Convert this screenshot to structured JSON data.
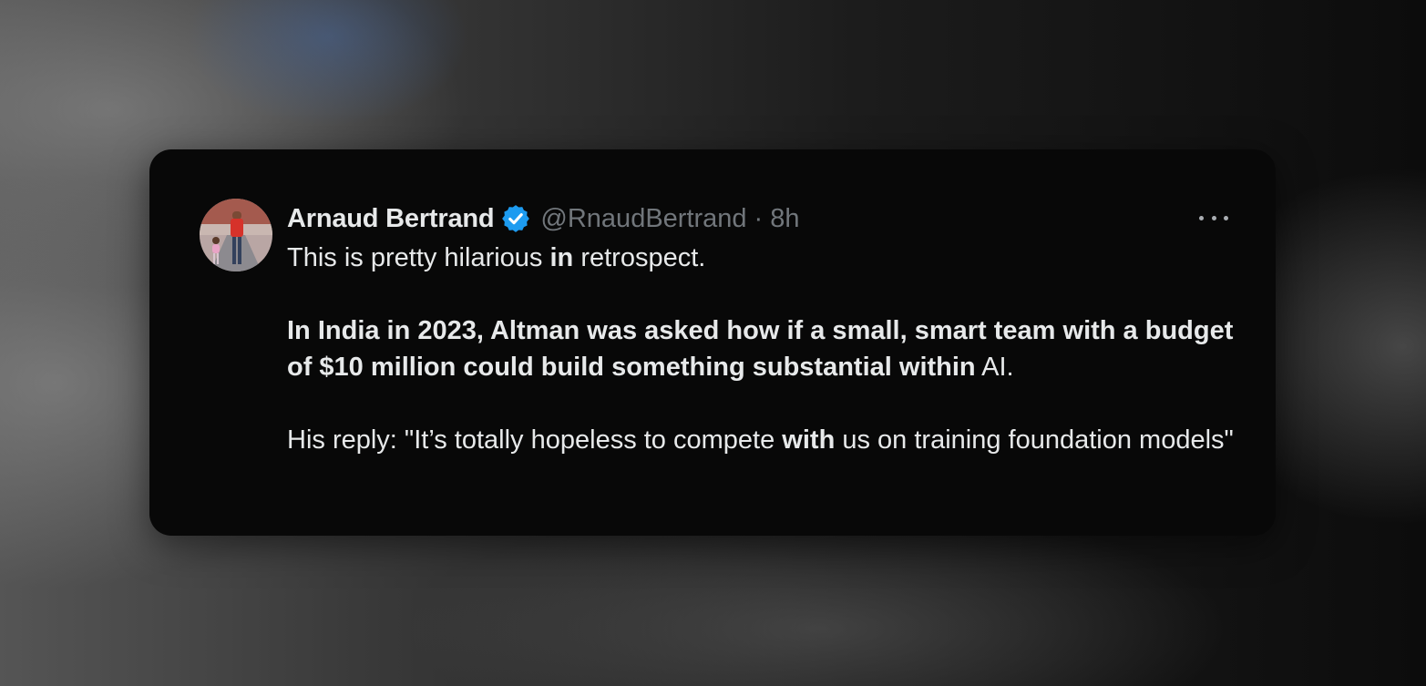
{
  "post": {
    "author_name": "Arnaud Bertrand",
    "handle": "@RnaudBertrand",
    "separator": "·",
    "time": "8h",
    "verified_icon": "verified-badge-icon",
    "more_icon": "more-options-icon",
    "badge_color": "#1d9bf0",
    "paragraphs": [
      {
        "segments": [
          {
            "text": "This is pretty hilarious ",
            "bold": false
          },
          {
            "text": "in",
            "bold": true
          },
          {
            "text": " retrospect.",
            "bold": false
          }
        ]
      },
      {
        "segments": [
          {
            "text": "In India in 2023, Altman was asked how if a small, smart team with a budget of $10 million could build something substantial within",
            "bold": true
          },
          {
            "text": " AI.",
            "bold": false
          }
        ]
      },
      {
        "segments": [
          {
            "text": "His reply: \"It’s totally hopeless to compete ",
            "bold": false
          },
          {
            "text": "with",
            "bold": true
          },
          {
            "text": " us on training foundation models\"",
            "bold": false
          }
        ]
      }
    ]
  }
}
